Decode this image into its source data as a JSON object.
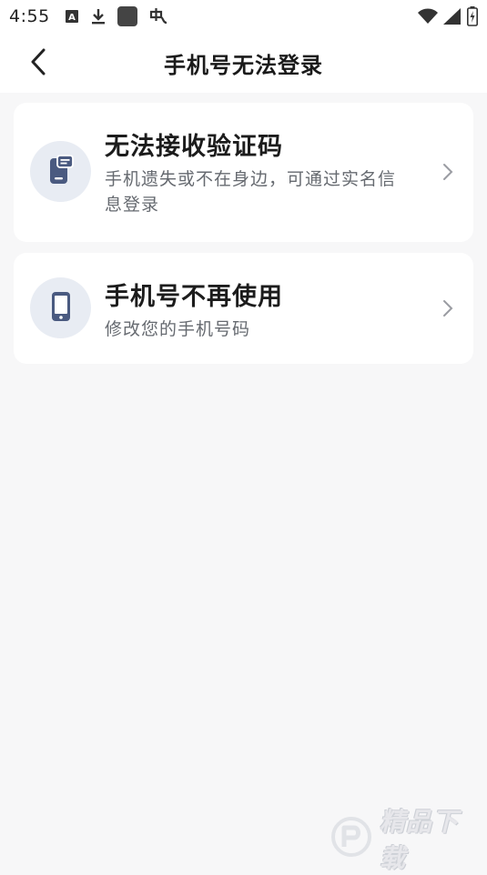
{
  "status_bar": {
    "time": "4:55",
    "left_icons": [
      "a-box-icon",
      "download-icon",
      "square-app-icon",
      "bug-icon"
    ],
    "right_icons": [
      "wifi-icon",
      "cell-signal-icon",
      "battery-icon"
    ]
  },
  "nav": {
    "back_icon": "chevron-left-icon",
    "title": "手机号无法登录"
  },
  "options": [
    {
      "icon": "phone-message-icon",
      "title": "无法接收验证码",
      "description": "手机遗失或不在身边，可通过实名信息登录"
    },
    {
      "icon": "phone-icon",
      "title": "手机号不再使用",
      "description": "修改您的手机号码"
    }
  ],
  "watermark": {
    "text": "精品下载"
  },
  "colors": {
    "background": "#f7f7f8",
    "card": "#ffffff",
    "icon_circle": "#e8ecf3",
    "icon_accent": "#4a5a80",
    "title_text": "#1c1c1c",
    "description_text": "#666a70"
  }
}
